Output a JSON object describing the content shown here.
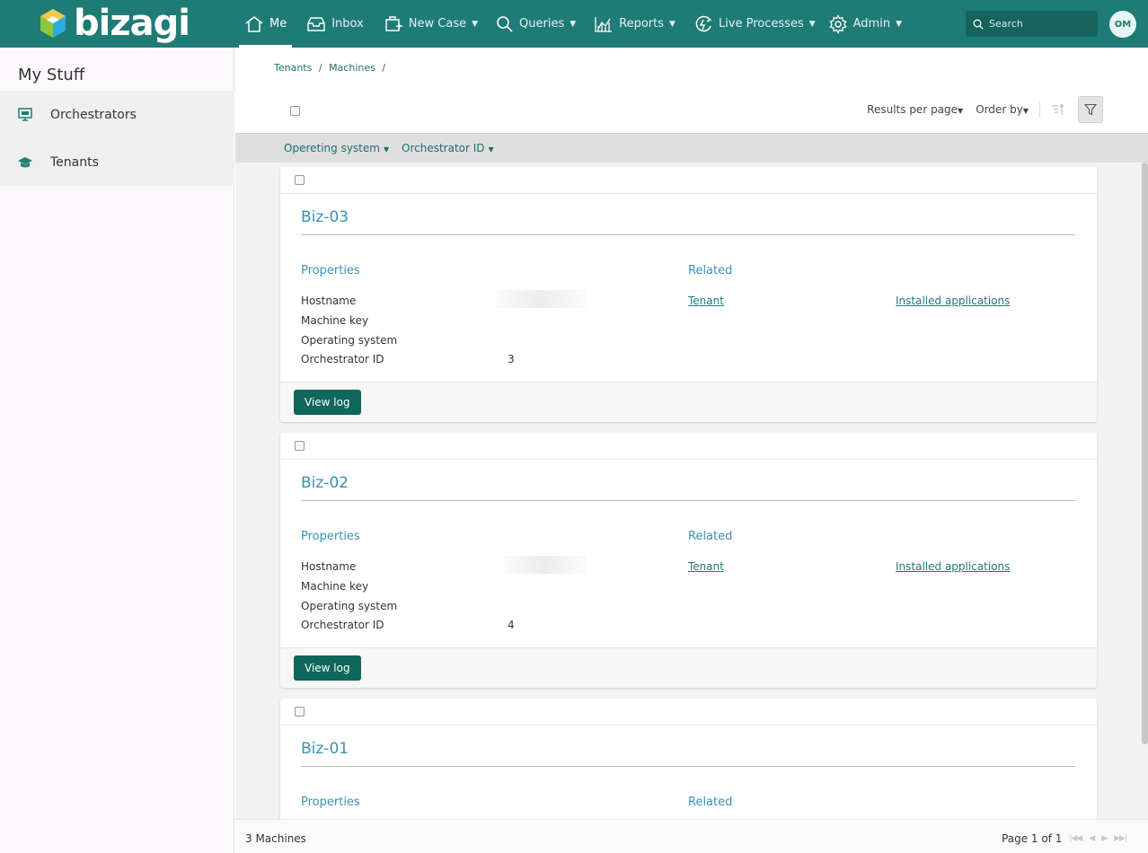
{
  "brand": {
    "name": "bizagi"
  },
  "nav": {
    "items": [
      {
        "label": "Me",
        "icon": "home-icon",
        "active": true
      },
      {
        "label": "Inbox",
        "icon": "inbox-icon"
      },
      {
        "label": "New Case",
        "icon": "new-case-icon"
      },
      {
        "label": "Queries",
        "icon": "search-icon"
      },
      {
        "label": "Reports",
        "icon": "reports-icon"
      },
      {
        "label": "Live Processes",
        "icon": "live-processes-icon"
      },
      {
        "label": "Admin",
        "icon": "gear-icon"
      }
    ],
    "search_placeholder": "Search",
    "user_initials": "OM"
  },
  "sidebar": {
    "title": "My Stuff",
    "items": [
      {
        "label": "Orchestrators",
        "icon": "monitor-icon"
      },
      {
        "label": "Tenants",
        "icon": "graduation-cap-icon"
      }
    ]
  },
  "breadcrumb": [
    "Tenants",
    "Machines"
  ],
  "toolbar": {
    "results_per_page": "Results per page",
    "order_by": "Order by"
  },
  "filters": [
    "Opereting system",
    "Orchestrator ID"
  ],
  "cards": [
    {
      "title": "Biz-03",
      "properties_label": "Properties",
      "related_label": "Related",
      "props": [
        "Hostname",
        "Machine key",
        "Operating system",
        "Orchestrator ID"
      ],
      "orchestrator_id": "3",
      "related_links": [
        "Tenant",
        "Installed applications"
      ],
      "button": "View log"
    },
    {
      "title": "Biz-02",
      "properties_label": "Properties",
      "related_label": "Related",
      "props": [
        "Hostname",
        "Machine key",
        "Operating system",
        "Orchestrator ID"
      ],
      "orchestrator_id": "4",
      "related_links": [
        "Tenant",
        "Installed applications"
      ],
      "button": "View log"
    },
    {
      "title": "Biz-01",
      "properties_label": "Properties",
      "related_label": "Related"
    }
  ],
  "status": {
    "count": "3 Machines",
    "page": "Page 1 of 1"
  },
  "colors": {
    "header": "#1f7b75",
    "accent": "#3a92b4",
    "button": "#0f665a"
  }
}
